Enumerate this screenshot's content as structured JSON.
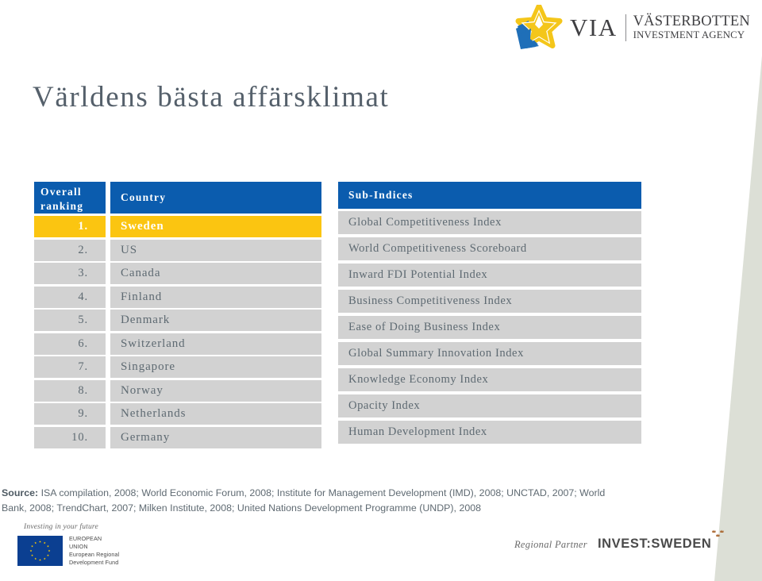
{
  "brand": {
    "mark_name": "via-star-logo",
    "acronym": "VIA",
    "line1": "VÄSTERBOTTEN",
    "line2": "INVESTMENT AGENCY",
    "colors": {
      "yellow": "#f4c61a",
      "blue": "#1f6fb8",
      "deep_blue": "#0b5cae"
    }
  },
  "title": "Världens bästa affärsklimat",
  "ranking_table": {
    "headers": {
      "rank": "Overall ranking",
      "country": "Country"
    },
    "rows": [
      {
        "rank": "1.",
        "country": "Sweden",
        "highlight": true
      },
      {
        "rank": "2.",
        "country": "US",
        "highlight": false
      },
      {
        "rank": "3.",
        "country": "Canada",
        "highlight": false
      },
      {
        "rank": "4.",
        "country": "Finland",
        "highlight": false
      },
      {
        "rank": "5.",
        "country": "Denmark",
        "highlight": false
      },
      {
        "rank": "6.",
        "country": "Switzerland",
        "highlight": false
      },
      {
        "rank": "7.",
        "country": "Singapore",
        "highlight": false
      },
      {
        "rank": "8.",
        "country": "Norway",
        "highlight": false
      },
      {
        "rank": "9.",
        "country": "Netherlands",
        "highlight": false
      },
      {
        "rank": "10.",
        "country": "Germany",
        "highlight": false
      }
    ]
  },
  "sub_indices_table": {
    "header": "Sub-Indices",
    "rows": [
      "Global Competitiveness Index",
      "World Competitiveness Scoreboard",
      "Inward FDI Potential Index",
      "Business Competitiveness Index",
      "Ease of Doing Business Index",
      "Global Summary Innovation Index",
      "Knowledge Economy Index",
      "Opacity Index",
      "Human Development Index"
    ]
  },
  "source": {
    "label": "Source:",
    "text": " ISA compilation, 2008; World Economic Forum, 2008; Institute for Management Development (IMD), 2008; UNCTAD, 2007; World Bank, 2008; TrendChart, 2007; Milken Institute, 2008; United Nations Development Programme (UNDP), 2008"
  },
  "footer": {
    "eu": {
      "tagline": "Investing in your future",
      "line1": "EUROPEAN",
      "line2": "UNION",
      "line3": "European Regional",
      "line4": "Development Fund",
      "flag_color": "#0b3f91",
      "star_color": "#ffcc00"
    },
    "partner": {
      "label": "Regional Partner",
      "name": "INVEST:SWEDEN",
      "crown_color": "#a8642c"
    }
  },
  "theme": {
    "header_blue": "#0b5cae",
    "highlight_yellow": "#fbc511",
    "row_gray": "#d2d2d2",
    "text_gray": "#5e6a72",
    "title_gray": "#55606b",
    "wedge_gray": "#dcdfd6"
  }
}
